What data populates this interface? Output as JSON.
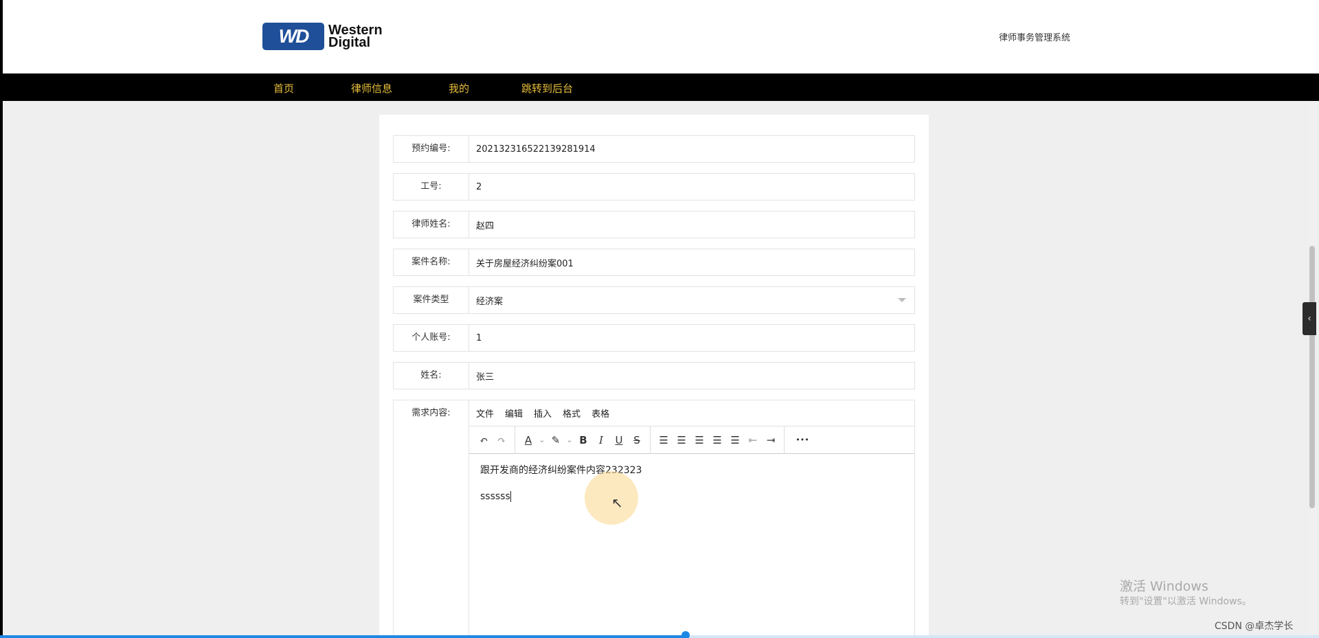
{
  "header": {
    "logo_mark": "WD",
    "logo_line1": "Western",
    "logo_line2": "Digital",
    "site_title": "律师事务管理系统"
  },
  "nav": [
    {
      "label": "首页"
    },
    {
      "label": "律师信息"
    },
    {
      "label": "我的"
    },
    {
      "label": "跳转到后台"
    }
  ],
  "form": {
    "booking_no": {
      "label": "预约编号:",
      "value": "202132316522139281914"
    },
    "staff_id": {
      "label": "工号:",
      "value": "2"
    },
    "lawyer_name": {
      "label": "律师姓名:",
      "value": "赵四"
    },
    "case_name": {
      "label": "案件名称:",
      "value": "关于房屋经济纠纷案001"
    },
    "case_type": {
      "label": "案件类型",
      "value": "经济案"
    },
    "account": {
      "label": "个人账号:",
      "value": "1"
    },
    "name": {
      "label": "姓名:",
      "value": "张三"
    },
    "requirement": {
      "label": "需求内容:",
      "menu": [
        "文件",
        "编辑",
        "插入",
        "格式",
        "表格"
      ],
      "lines": [
        "跟开发商的经济纠纷案件内容232323",
        "ssssss"
      ]
    }
  },
  "toolbar_icons": {
    "undo": "↶",
    "redo": "↷",
    "font_color": "A",
    "highlight": "✎",
    "bold": "B",
    "italic": "I",
    "underline": "U",
    "strike": "S",
    "line_height": "☰",
    "align_left": "☰",
    "align_center": "☰",
    "align_right": "☰",
    "justify": "☰",
    "outdent": "⇤",
    "indent": "⇥",
    "more": "•••",
    "caret": "⌄"
  },
  "watermark": {
    "title": "激活 Windows",
    "subtitle": "转到\"设置\"以激活 Windows。"
  },
  "csdn": "CSDN @卓杰学长",
  "video_progress": 0.52,
  "colors": {
    "nav_bg": "#000000",
    "nav_text": "#e8bf3c",
    "logo_blue": "#1f4f98",
    "progress": "#1e88e5"
  }
}
